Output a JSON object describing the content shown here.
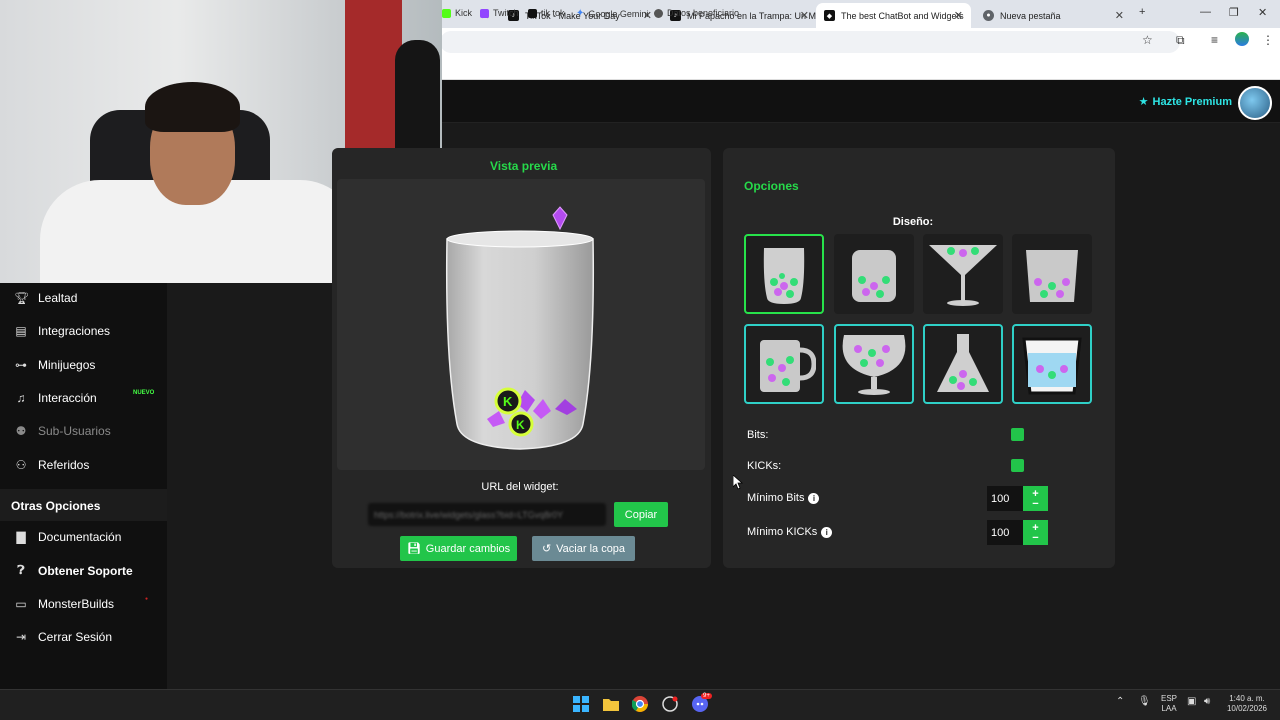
{
  "browser": {
    "tabs": [
      {
        "title": "",
        "active": false
      },
      {
        "title": "TikTok - Make Your Day",
        "active": false
      },
      {
        "title": "Mi Papacho en la Trampa: Un M",
        "active": false
      },
      {
        "title": "The best ChatBot and Widgets",
        "active": true
      },
      {
        "title": "Nueva pestaña",
        "active": false
      }
    ],
    "bookmarks": [
      "Kick",
      "Twitch",
      "tik tok",
      "Google Gemini",
      "Datos beneficiario"
    ]
  },
  "header": {
    "premium_label": "Hazte Premium"
  },
  "sidebar": {
    "items": [
      {
        "label": "Lealtad",
        "icon": "trophy-icon"
      },
      {
        "label": "Integraciones",
        "icon": "integrations-icon"
      },
      {
        "label": "Minijuegos",
        "icon": "gamepad-icon"
      },
      {
        "label": "Interacción",
        "icon": "music-icon",
        "badge": "NUEVO"
      },
      {
        "label": "Sub-Usuarios",
        "icon": "users-icon",
        "disabled": true
      },
      {
        "label": "Referidos",
        "icon": "referrals-icon"
      }
    ],
    "section_title": "Otras Opciones",
    "other_items": [
      {
        "label": "Documentación",
        "icon": "book-icon"
      },
      {
        "label": "Obtener Soporte",
        "icon": "question-icon"
      },
      {
        "label": "MonsterBuilds",
        "icon": "laptop-icon"
      },
      {
        "label": "Cerrar Sesión",
        "icon": "logout-icon"
      }
    ]
  },
  "preview": {
    "title": "Vista previa",
    "url_label": "URL del widget:",
    "url_value": "https://botrix.live/widgets/glass?bid=LTGvq8r0Y",
    "copy_label": "Copiar",
    "save_label": "Guardar cambios",
    "empty_label": "Vaciar la copa"
  },
  "options": {
    "title": "Opciones",
    "design_label": "Diseño:",
    "designs": [
      "glass",
      "jar",
      "martini",
      "tumbler",
      "mug",
      "snifter",
      "flask",
      "bucket"
    ],
    "selected_design": 0,
    "bits_label": "Bits:",
    "kicks_label": "KICKs:",
    "min_bits_label": "Mínimo Bits",
    "min_bits_value": "100",
    "min_kicks_label": "Mínimo KICKs",
    "min_kicks_value": "100"
  },
  "taskbar": {
    "lang": "ESP",
    "lang2": "LAA",
    "time": "1:40 a. m.",
    "date": "10/02/2026",
    "discord_badge": "9+"
  },
  "colors": {
    "accent_green": "#22c54a",
    "title_green": "#26d94a",
    "teal_border": "#2fd0c7",
    "premium_cyan": "#2ee5e5"
  }
}
